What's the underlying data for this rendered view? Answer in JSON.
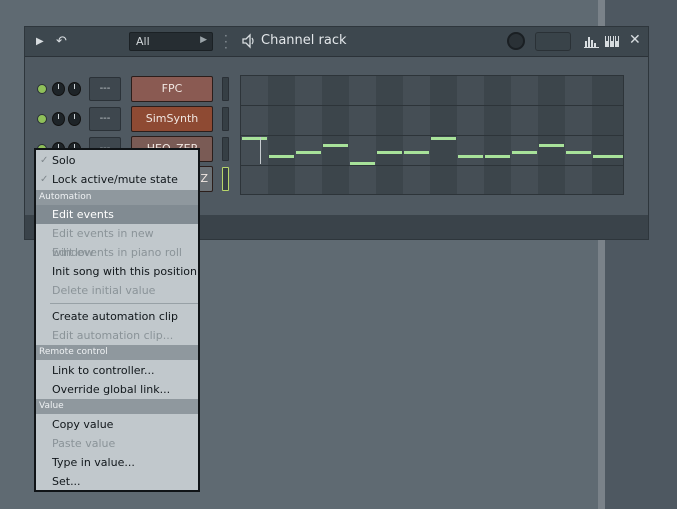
{
  "window": {
    "title": "Channel rack",
    "filter": "All"
  },
  "channels": [
    {
      "name": "FPC",
      "route": "---",
      "color": "#8a5a52"
    },
    {
      "name": "SimSynth",
      "route": "---",
      "color": "#8e4a33"
    },
    {
      "name": "HEQ_ZEP",
      "route": "---",
      "color": "#7a5b55"
    },
    {
      "name": "nZ",
      "route": "",
      "color": "#6b7176"
    }
  ],
  "menu": {
    "items_top": [
      {
        "label": "Solo",
        "checked": true
      },
      {
        "label": "Lock active/mute state",
        "checked": true
      }
    ],
    "section_automation": "Automation",
    "automation_items": [
      {
        "label": "Edit events",
        "state": "highlighted"
      },
      {
        "label": "Edit events in new window",
        "state": "disabled"
      },
      {
        "label": "Edit events in piano roll",
        "state": "disabled"
      },
      {
        "label": "Init song with this position",
        "state": "enabled"
      },
      {
        "label": "Delete initial value",
        "state": "disabled"
      }
    ],
    "automation_clip_items": [
      {
        "label": "Create automation clip",
        "state": "enabled"
      },
      {
        "label": "Edit automation clip...",
        "state": "disabled"
      }
    ],
    "section_remote": "Remote control",
    "remote_items": [
      {
        "label": "Link to controller...",
        "state": "enabled"
      },
      {
        "label": "Override global link...",
        "state": "enabled"
      }
    ],
    "section_value": "Value",
    "value_items": [
      {
        "label": "Copy value",
        "state": "enabled"
      },
      {
        "label": "Paste value",
        "state": "disabled"
      },
      {
        "label": "Type in value...",
        "state": "enabled"
      },
      {
        "label": "Set...",
        "state": "enabled"
      }
    ]
  },
  "icons": {
    "play": "play-icon",
    "undo": "undo-icon",
    "speaker": "speaker-icon",
    "graph": "graph-icon",
    "keyboard": "keyboard-icon",
    "close": "close-icon"
  },
  "colors": {
    "note": "#a8e29a",
    "led": "#8fc05a"
  }
}
